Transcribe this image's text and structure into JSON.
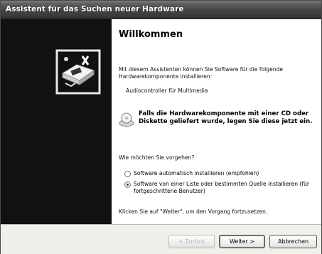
{
  "window": {
    "title": "Assistent für das Suchen neuer Hardware"
  },
  "main": {
    "heading": "Willkommen",
    "intro": "Mit diesem Assistenten können Sie Software für die folgende Hardwarekomponente installieren:",
    "device_name": "Audiocontroller für Multimedia",
    "cd_notice": "Falls die Hardwarekomponente mit einer CD oder Diskette geliefert wurde, legen Sie diese jetzt ein.",
    "question": "Wie möchten Sie vorgehen?",
    "options": [
      {
        "label": "Software automatisch installieren (empfohlen)",
        "selected": false
      },
      {
        "label": "Software von einer Liste oder bestimmten Quelle installieren (für fortgeschrittene Benutzer)",
        "selected": true
      }
    ],
    "continue_hint": "Klicken Sie auf \"Weiter\", um den Vorgang fortzusetzen."
  },
  "buttons": {
    "back": "< Zurück",
    "next": "Weiter >",
    "cancel": "Abbrechen"
  },
  "icons": {
    "wizard": "hardware-wizard-icon",
    "cd": "cd-icon"
  }
}
